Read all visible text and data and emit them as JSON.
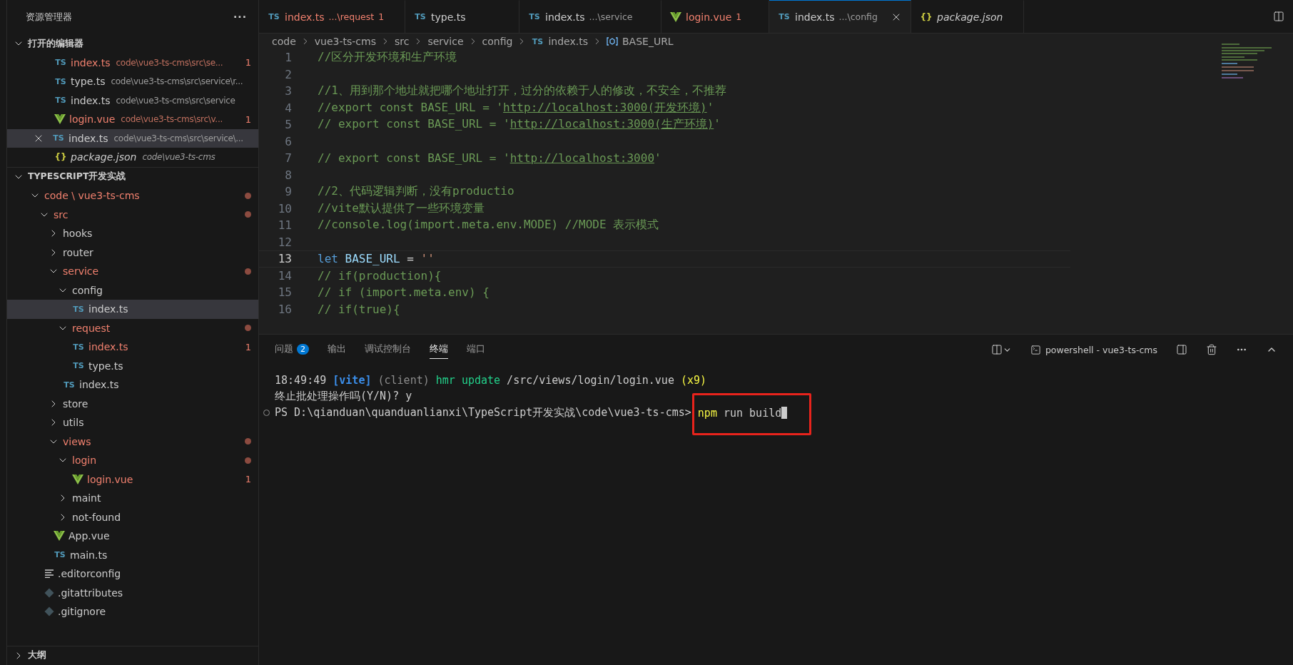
{
  "sidebar": {
    "title": "资源管理器",
    "more": "···",
    "open_editors": {
      "title": "打开的编辑器",
      "expanded": true,
      "items": [
        {
          "name": "index.ts",
          "path": "code\\vue3-ts-cms\\src\\se...",
          "icon_text": "TS",
          "kind": "ts",
          "error": true,
          "badge": "1",
          "selected": false,
          "preview": false
        },
        {
          "name": "type.ts",
          "path": "code\\vue3-ts-cms\\src\\service\\r...",
          "icon_text": "TS",
          "kind": "ts",
          "error": false,
          "selected": false,
          "preview": false
        },
        {
          "name": "index.ts",
          "path": "code\\vue3-ts-cms\\src\\service",
          "icon_text": "TS",
          "kind": "ts",
          "error": false,
          "selected": false,
          "preview": false
        },
        {
          "name": "login.vue",
          "path": "code\\vue3-ts-cms\\src\\v...",
          "kind": "vue",
          "error": true,
          "badge": "1",
          "selected": false,
          "preview": false
        },
        {
          "name": "index.ts",
          "path": "code\\vue3-ts-cms\\src\\service\\...",
          "icon_text": "TS",
          "kind": "ts",
          "error": false,
          "selected": true,
          "preview": false
        },
        {
          "name": "package.json",
          "path": "code\\vue3-ts-cms",
          "icon_text": "{}",
          "kind": "json",
          "error": false,
          "selected": false,
          "preview": true
        }
      ]
    },
    "project": {
      "title": "TYPESCRIPT开发实战",
      "expanded": true,
      "items": [
        {
          "name": "code \\ vue3-ts-cms",
          "kind": "folder",
          "expanded": true,
          "error": true,
          "dot": true,
          "selected": false,
          "children": [
            {
              "name": "src",
              "kind": "folder",
              "expanded": true,
              "error": true,
              "dot": true,
              "selected": false,
              "children": [
                {
                  "name": "hooks",
                  "kind": "folder",
                  "expanded": false,
                  "error": false,
                  "selected": false
                },
                {
                  "name": "router",
                  "kind": "folder",
                  "expanded": false,
                  "error": false,
                  "selected": false
                },
                {
                  "name": "service",
                  "kind": "folder",
                  "expanded": true,
                  "error": true,
                  "dot": true,
                  "selected": false,
                  "children": [
                    {
                      "name": "config",
                      "kind": "folder",
                      "expanded": true,
                      "error": false,
                      "selected": false,
                      "children": [
                        {
                          "name": "index.ts",
                          "kind": "ts",
                          "icon_text": "TS",
                          "error": false,
                          "selected": true
                        }
                      ]
                    },
                    {
                      "name": "request",
                      "kind": "folder",
                      "expanded": true,
                      "error": true,
                      "dot": true,
                      "selected": false,
                      "children": [
                        {
                          "name": "index.ts",
                          "kind": "ts",
                          "icon_text": "TS",
                          "error": true,
                          "badge": "1",
                          "selected": false
                        },
                        {
                          "name": "type.ts",
                          "kind": "ts",
                          "icon_text": "TS",
                          "error": false,
                          "selected": false
                        }
                      ]
                    },
                    {
                      "name": "index.ts",
                      "kind": "ts",
                      "icon_text": "TS",
                      "error": false,
                      "selected": false
                    }
                  ]
                },
                {
                  "name": "store",
                  "kind": "folder",
                  "expanded": false,
                  "error": false,
                  "selected": false
                },
                {
                  "name": "utils",
                  "kind": "folder",
                  "expanded": false,
                  "error": false,
                  "selected": false
                },
                {
                  "name": "views",
                  "kind": "folder",
                  "expanded": true,
                  "error": true,
                  "dot": true,
                  "selected": false,
                  "children": [
                    {
                      "name": "login",
                      "kind": "folder",
                      "expanded": true,
                      "error": true,
                      "dot": true,
                      "selected": false,
                      "children": [
                        {
                          "name": "login.vue",
                          "kind": "vue",
                          "error": true,
                          "badge": "1",
                          "selected": false
                        }
                      ]
                    },
                    {
                      "name": "maint",
                      "kind": "folder",
                      "expanded": false,
                      "error": false,
                      "selected": false
                    },
                    {
                      "name": "not-found",
                      "kind": "folder",
                      "expanded": false,
                      "error": false,
                      "selected": false
                    }
                  ]
                },
                {
                  "name": "App.vue",
                  "kind": "vue",
                  "error": false,
                  "selected": false
                },
                {
                  "name": "main.ts",
                  "kind": "ts",
                  "icon_text": "TS",
                  "error": false,
                  "selected": false
                }
              ]
            },
            {
              "name": ".editorconfig",
              "kind": "config",
              "error": false,
              "selected": false
            },
            {
              "name": ".gitattributes",
              "kind": "git",
              "error": false,
              "selected": false
            },
            {
              "name": ".gitignore",
              "kind": "git",
              "error": false,
              "selected": false
            }
          ]
        }
      ]
    },
    "outline": {
      "title": "大纲",
      "expanded": false
    }
  },
  "tabs": [
    {
      "name": "index.ts",
      "detail": "...\\request",
      "badge": "1",
      "icon_text": "TS",
      "kind": "ts",
      "error": true,
      "selected": false,
      "preview": false
    },
    {
      "name": "type.ts",
      "icon_text": "TS",
      "kind": "ts",
      "error": false,
      "selected": false,
      "preview": false
    },
    {
      "name": "index.ts",
      "detail": "...\\service",
      "icon_text": "TS",
      "kind": "ts",
      "error": false,
      "selected": false,
      "preview": false
    },
    {
      "name": "login.vue",
      "badge": "1",
      "kind": "vue",
      "error": true,
      "selected": false,
      "preview": false
    },
    {
      "name": "index.ts",
      "detail": "...\\config",
      "icon_text": "TS",
      "kind": "ts",
      "error": false,
      "selected": true,
      "preview": false
    },
    {
      "name": "package.json",
      "icon_text": "{}",
      "kind": "json",
      "error": false,
      "selected": false,
      "preview": true
    }
  ],
  "breadcrumb": [
    {
      "text": "code"
    },
    {
      "text": "vue3-ts-cms"
    },
    {
      "text": "src"
    },
    {
      "text": "service"
    },
    {
      "text": "config"
    },
    {
      "text": "index.ts",
      "icon_text": "TS",
      "kind": "ts"
    },
    {
      "text": "BASE_URL",
      "kind": "symbol"
    }
  ],
  "code": [
    {
      "number": "1",
      "current": false,
      "tokens": [
        {
          "kind": "comment",
          "text": "//区分开发环境和生产环境"
        }
      ]
    },
    {
      "number": "2",
      "current": false
    },
    {
      "number": "3",
      "current": false,
      "tokens": [
        {
          "kind": "comment",
          "text": "//1、用到那个地址就把哪个地址打开，过分的依赖于人的修改，不安全，不推荐"
        }
      ]
    },
    {
      "number": "4",
      "current": false,
      "tokens": [
        {
          "kind": "comment",
          "text": "//export const BASE_URL = '"
        },
        {
          "kind": "link",
          "text": "http://localhost:3000(开发环境)"
        },
        {
          "kind": "comment",
          "text": "'"
        }
      ]
    },
    {
      "number": "5",
      "current": false,
      "tokens": [
        {
          "kind": "comment",
          "text": "// export const BASE_URL = '"
        },
        {
          "kind": "link",
          "text": "http://localhost:3000(生产环境)"
        },
        {
          "kind": "comment",
          "text": "'"
        }
      ]
    },
    {
      "number": "6",
      "current": false
    },
    {
      "number": "7",
      "current": false,
      "tokens": [
        {
          "kind": "comment",
          "text": "// export const BASE_URL = '"
        },
        {
          "kind": "link",
          "text": "http://localhost:3000"
        },
        {
          "kind": "comment",
          "text": "'"
        }
      ]
    },
    {
      "number": "8",
      "current": false
    },
    {
      "number": "9",
      "current": false,
      "tokens": [
        {
          "kind": "comment",
          "text": "//2、代码逻辑判断，没有productio"
        }
      ]
    },
    {
      "number": "10",
      "current": false,
      "tokens": [
        {
          "kind": "comment",
          "text": "//vite默认提供了一些环境变量"
        }
      ]
    },
    {
      "number": "11",
      "current": false,
      "tokens": [
        {
          "kind": "comment",
          "text": "//console.log(import.meta.env.MODE) //MODE 表示模式"
        }
      ]
    },
    {
      "number": "12",
      "current": false
    },
    {
      "number": "13",
      "current": true,
      "tokens": [
        {
          "kind": "keyword",
          "text": "let"
        },
        {
          "kind": "variable",
          "text": " BASE_URL"
        },
        {
          "kind": "plain",
          "text": " = "
        },
        {
          "kind": "string",
          "text": "''"
        }
      ]
    },
    {
      "number": "14",
      "current": false,
      "tokens": [
        {
          "kind": "comment",
          "text": "// if(production){"
        }
      ]
    },
    {
      "number": "15",
      "current": false,
      "tokens": [
        {
          "kind": "comment",
          "text": "// if (import.meta.env) {"
        }
      ]
    },
    {
      "number": "16",
      "current": false,
      "tokens": [
        {
          "kind": "comment",
          "text": "// if(true){"
        }
      ]
    }
  ],
  "panel": {
    "tabs": [
      {
        "label": "问题",
        "badge": "2",
        "selected": false
      },
      {
        "label": "输出",
        "selected": false
      },
      {
        "label": "调试控制台",
        "selected": false
      },
      {
        "label": "终端",
        "selected": true
      },
      {
        "label": "端口",
        "selected": false
      }
    ],
    "terminal_name": "powershell - vue3-ts-cms",
    "lines": [
      {
        "prompt": false,
        "segments": [
          {
            "kind": "plain",
            "text": "18:49:49 "
          },
          {
            "kind": "vite",
            "text": "[vite]"
          },
          {
            "kind": "dim",
            "text": " (client)"
          },
          {
            "kind": "green",
            "text": " hmr update"
          },
          {
            "kind": "plain",
            "text": " /src/views/login/login.vue"
          },
          {
            "kind": "yellow",
            "text": " (x9)"
          }
        ]
      },
      {
        "prompt": false,
        "segments": [
          {
            "kind": "plain",
            "text": "终止批处理操作吗(Y/N)? y"
          }
        ]
      },
      {
        "prompt": true,
        "segments": [
          {
            "kind": "plain",
            "text": "PS D:\\qianduan\\quanduanlianxi\\TypeScript开发实战\\code\\vue3-ts-cms> "
          },
          {
            "kind": "yellow",
            "text": "npm",
            "highlighted": true
          },
          {
            "kind": "plain",
            "text": " run build",
            "highlighted": true,
            "cursor": true
          }
        ]
      }
    ]
  }
}
